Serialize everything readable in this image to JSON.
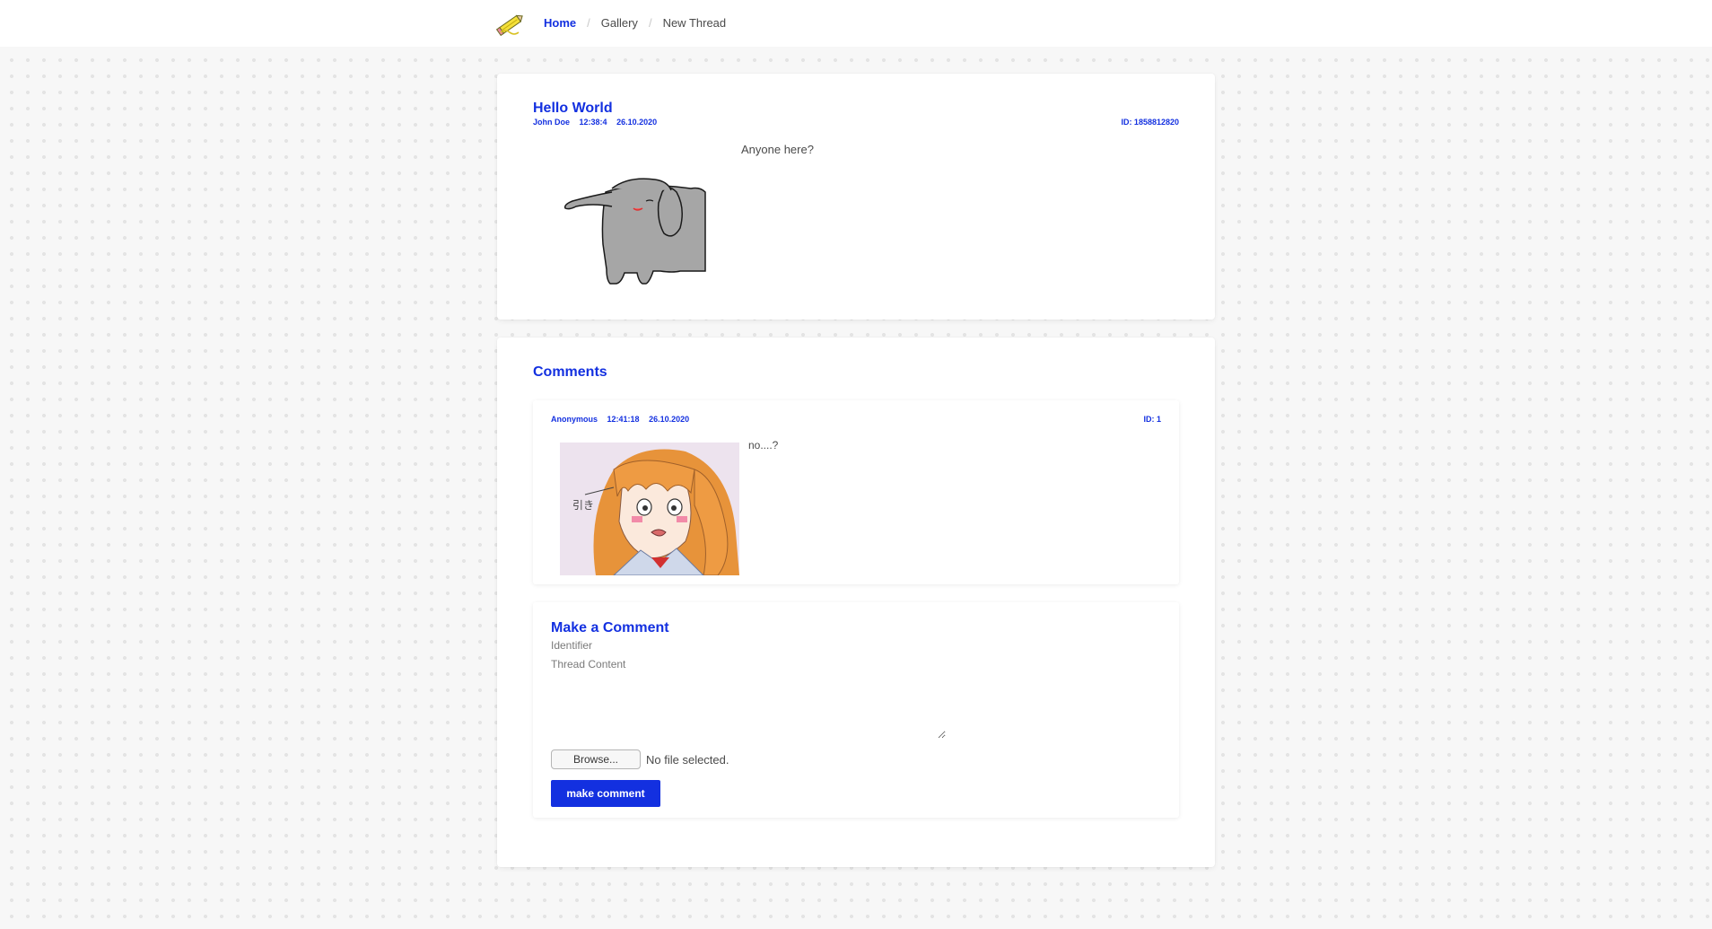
{
  "nav": {
    "logo_icon": "pencil-logo-icon",
    "items": [
      {
        "label": "Home",
        "active": true
      },
      {
        "label": "Gallery",
        "active": false
      },
      {
        "label": "New Thread",
        "active": false
      }
    ],
    "separator": "/"
  },
  "thread": {
    "title": "Hello World",
    "author": "John Doe",
    "time": "12:38:4",
    "date": "26.10.2020",
    "id_label": "ID: 1858812820",
    "body": "Anyone here?",
    "image": "elephant-drawing"
  },
  "comments": {
    "title": "Comments",
    "items": [
      {
        "author": "Anonymous",
        "time": "12:41:18",
        "date": "26.10.2020",
        "id_label": "ID: 1",
        "body": "no....?",
        "image": "anime-girl-drawing"
      }
    ]
  },
  "form": {
    "title": "Make a Comment",
    "identifier_placeholder": "Identifier",
    "content_placeholder": "Thread Content",
    "browse_label": "Browse...",
    "file_status": "No file selected.",
    "submit_label": "make comment"
  },
  "colors": {
    "accent": "#1330e0",
    "text": "#4a4a4a",
    "background": "#f7f7f7"
  }
}
